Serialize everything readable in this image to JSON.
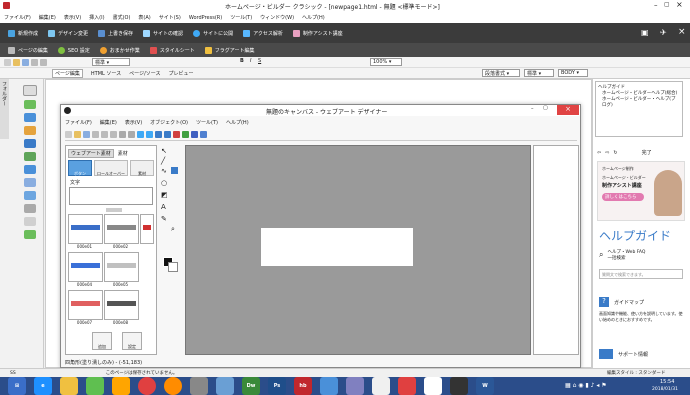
{
  "app": {
    "title": "ホームページ・ビルダー クラシック - [newpage1.html - 無題 <標準モード>]",
    "menu": [
      "ファイル(F)",
      "編集(E)",
      "表示(V)",
      "挿入(I)",
      "書式(O)",
      "表(A)",
      "サイト(S)",
      "WordPress(R)",
      "ツール(T)",
      "ウィンドウ(W)",
      "ヘルプ(H)"
    ],
    "ribbon1": [
      "新規作成",
      "デザイン変更",
      "上書き保存",
      "サイトの確認",
      "サイトに公開",
      "アクセス解析",
      "制作アシスト講座"
    ],
    "ribbon2": [
      "ページの編集",
      "SEO 設定",
      "おまかせ作業",
      "スタイルシート",
      "フラグアート編集"
    ],
    "toolbar_style": "標準",
    "edit_tabs": [
      "ページ編集",
      "HTML ソース",
      "ページ/ソース",
      "プレビュー"
    ],
    "zoom": "100%",
    "side_label": "フォルダー",
    "style_dropdowns": [
      "段落書式",
      "標準",
      "BODY"
    ]
  },
  "designer": {
    "title": "無題のキャンバス - ウェブアート デザイナー",
    "menu": [
      "ファイル(F)",
      "編集(E)",
      "表示(V)",
      "オブジェクト(O)",
      "ツール(T)",
      "ヘルプ(H)"
    ],
    "panel_tabs": [
      "ウェブアート素材",
      "素材"
    ],
    "category_buttons": [
      "ボタン",
      "ロールオーバー",
      "素材"
    ],
    "text_label": "文字",
    "templates": [
      "000e01",
      "000e02",
      "000e03",
      "000e04",
      "000e05",
      "000e06",
      "000e07",
      "000e08",
      "000e09"
    ],
    "bottom_buttons": [
      "追加",
      "設定"
    ],
    "status": "四角形(塗り潰しのみ) - (-51,183)"
  },
  "right_panel": {
    "help_tree": [
      "ヘルプガイド",
      "ホームページ・ビルダーヘルプ(総合)",
      "ホームページ・ビルダー・ヘルプ(ブログ)"
    ],
    "nav_label": "完了",
    "ad_line1": "ホームページ制作",
    "ad_line2": "ホームページ・ビルダー",
    "ad_line3": "制作アシスト講座",
    "ad_button": "詳しくはこちら",
    "help_title": "ヘルプガイド",
    "help_item1": "ヘルプ・Web FAQ\n一括検索",
    "help_search_ph": "質問文で検索できます。",
    "help_item2": "ガイドマップ",
    "help_item2_desc": "画面知識や機能、使い方を説明しています。使い始めのときにおすすめです。",
    "help_item3": "サポート情報"
  },
  "statusbar": {
    "left": "SS",
    "mid": "このページは保存されていません。",
    "right": "編集スタイル : スタンダード"
  },
  "taskbar": {
    "time": "15:54",
    "date": "2018/01/31"
  }
}
